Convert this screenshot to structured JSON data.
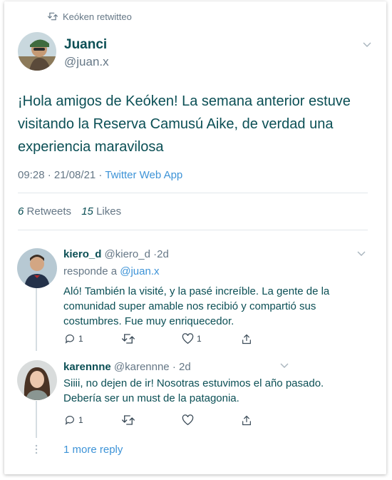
{
  "retweet_banner": {
    "text": "Keóken retwitteo",
    "icon": "retweet-icon"
  },
  "tweet": {
    "author_name": "Juanci",
    "author_handle": "@juan.x",
    "text": "¡Hola amigos de Keóken! La semana anterior estuve visitando la Reserva Camusú Aike, de verdad una experiencia maravilosa",
    "timestamp": "09:28 · 21/08/21 ·",
    "source": "Twitter Web App",
    "retweets_count": "6",
    "retweets_label": "Retweets",
    "likes_count": "15",
    "likes_label": "Likes"
  },
  "replies": [
    {
      "name": "kiero_d",
      "handle": "@kiero_d",
      "time": "·2d",
      "replying_prefix": "responde a",
      "replying_to": "@juan.x",
      "text": "Aló! También la visité, y la pasé increíble. La gente de la comunidad super amable nos recibió y compartió sus costumbres. Fue muy enriquecedor.",
      "reply_count": "1",
      "retweet_count": "",
      "like_count": "1"
    },
    {
      "name": "karennne",
      "handle": "@karennne",
      "time": "· 2d",
      "text": "Siiii, no dejen de ir! Nosotras estuvimos el año pasado. Debería ser un must de la patagonia.",
      "reply_count": "1",
      "retweet_count": "",
      "like_count": ""
    }
  ],
  "more_replies": {
    "label": "1 more reply"
  },
  "colors": {
    "text_accent": "#0b4f55",
    "link": "#3d93d7",
    "muted": "#657786",
    "divider": "#e2e7eb"
  }
}
